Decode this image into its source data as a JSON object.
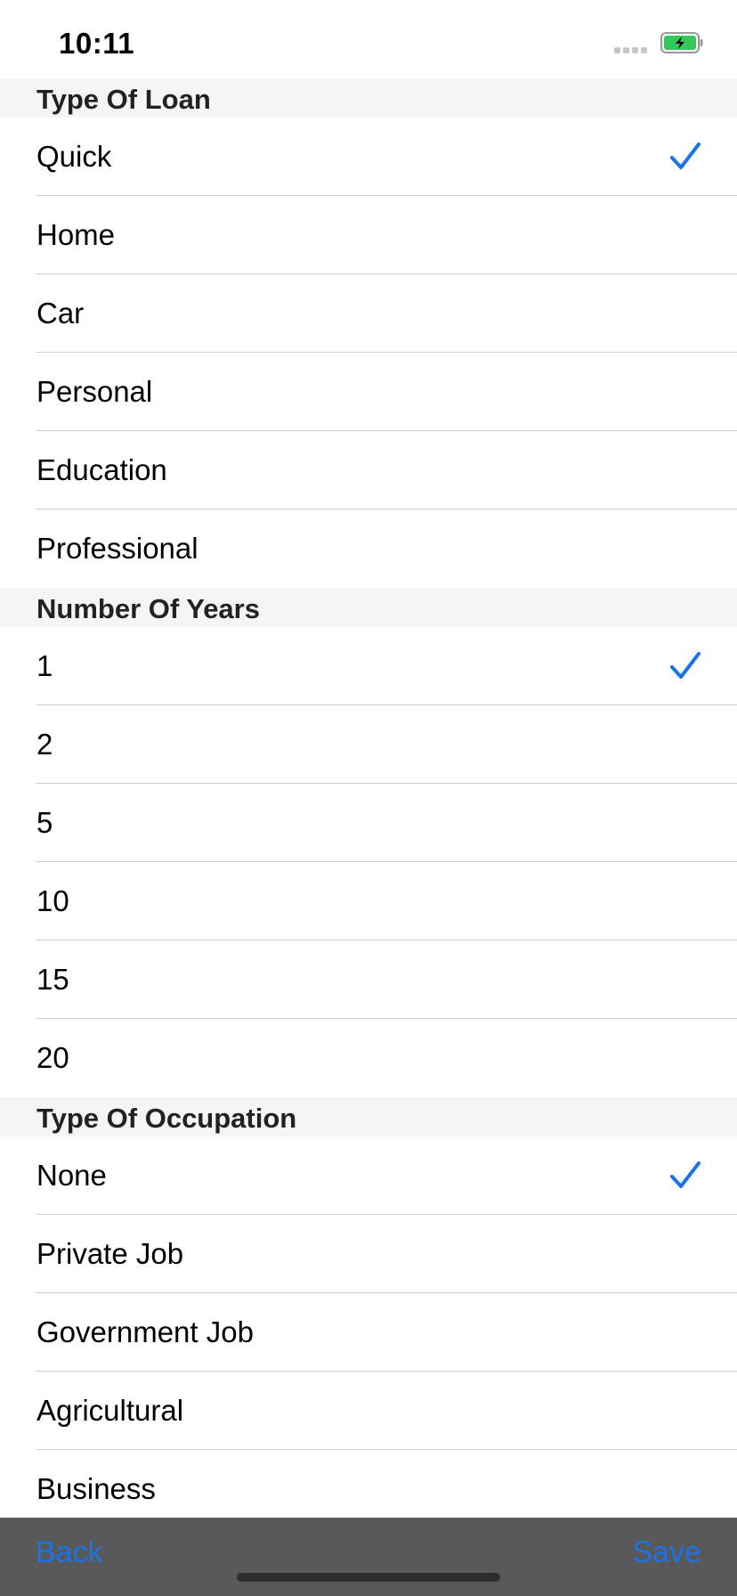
{
  "status_bar": {
    "time": "10:11"
  },
  "colors": {
    "accent": "#1a73e8",
    "toolbar_bg": "#595959",
    "battery": "#34c759"
  },
  "sections": [
    {
      "title": "Type Of Loan",
      "items": [
        {
          "label": "Quick",
          "selected": true
        },
        {
          "label": "Home",
          "selected": false
        },
        {
          "label": "Car",
          "selected": false
        },
        {
          "label": "Personal",
          "selected": false
        },
        {
          "label": "Education",
          "selected": false
        },
        {
          "label": "Professional",
          "selected": false
        }
      ]
    },
    {
      "title": "Number Of Years",
      "items": [
        {
          "label": "1",
          "selected": true
        },
        {
          "label": "2",
          "selected": false
        },
        {
          "label": "5",
          "selected": false
        },
        {
          "label": "10",
          "selected": false
        },
        {
          "label": "15",
          "selected": false
        },
        {
          "label": "20",
          "selected": false
        }
      ]
    },
    {
      "title": "Type Of Occupation",
      "items": [
        {
          "label": "None",
          "selected": true
        },
        {
          "label": "Private Job",
          "selected": false
        },
        {
          "label": "Government Job",
          "selected": false
        },
        {
          "label": "Agricultural",
          "selected": false
        },
        {
          "label": "Business",
          "selected": false
        }
      ]
    }
  ],
  "toolbar": {
    "back_label": "Back",
    "save_label": "Save"
  }
}
